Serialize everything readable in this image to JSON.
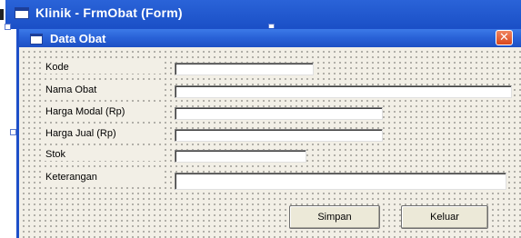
{
  "ide": {
    "title": "Klinik - FrmObat (Form)"
  },
  "form": {
    "title": "Data Obat",
    "close_symbol": "✕",
    "fields": [
      {
        "label": "Kode",
        "value": ""
      },
      {
        "label": "Nama Obat",
        "value": ""
      },
      {
        "label": "Harga Modal (Rp)",
        "value": ""
      },
      {
        "label": "Harga Jual (Rp)",
        "value": ""
      },
      {
        "label": "Stok",
        "value": ""
      },
      {
        "label": "Keterangan",
        "value": ""
      }
    ],
    "buttons": {
      "save": "Simpan",
      "exit": "Keluar"
    }
  },
  "icons": [
    "form-icon",
    "window-icon",
    "close-icon"
  ],
  "colors": {
    "titlebar": "#2a63d8",
    "close": "#d9471d",
    "client": "#f2efe6"
  }
}
